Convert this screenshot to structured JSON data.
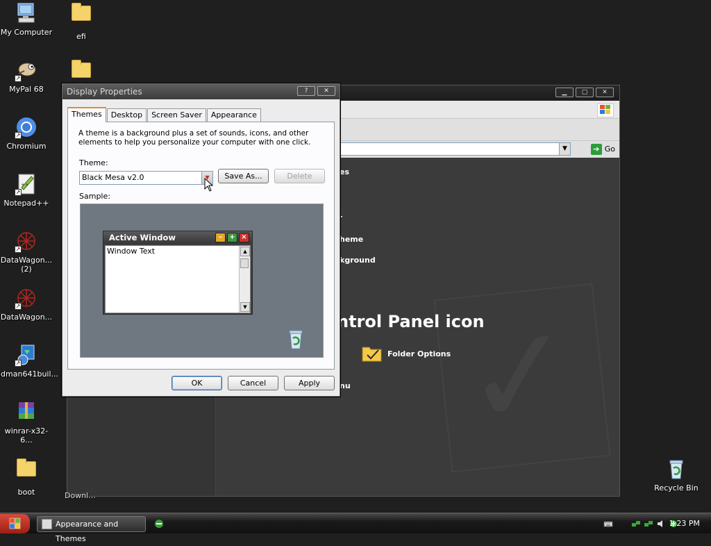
{
  "desktop": {
    "icons_left": [
      {
        "label": "My Computer"
      },
      {
        "label": "MyPal 68"
      },
      {
        "label": "Chromium"
      },
      {
        "label": "Notepad++"
      },
      {
        "label": "DataWagon... (2)"
      },
      {
        "label": "DataWagon..."
      },
      {
        "label": "idman641buil..."
      },
      {
        "label": "winrar-x32-6..."
      },
      {
        "label": "boot"
      }
    ],
    "icons_col2": [
      {
        "label": "efi"
      }
    ],
    "recycle_bin": {
      "label": "Recycle Bin"
    }
  },
  "control_panel": {
    "go_label": "Go",
    "partial_items": {
      "a": "es",
      "b": "-",
      "c": "heme",
      "d": "kground",
      "e": "nu"
    },
    "heading": "ntrol Panel icon",
    "folder_options": "Folder Options",
    "behind_label": "Downl..."
  },
  "dialog": {
    "title": "Display Properties",
    "help_btn": "?",
    "close_btn": "✕",
    "tabs": [
      "Themes",
      "Desktop",
      "Screen Saver",
      "Appearance"
    ],
    "description": "A theme is a background plus a set of sounds, icons, and other elements to help you personalize your computer with one click.",
    "theme_label": "Theme:",
    "theme_value": "Black Mesa v2.0",
    "save_as": "Save As...",
    "delete": "Delete",
    "sample_label": "Sample:",
    "sample": {
      "active_window_title": "Active Window",
      "window_text": "Window Text"
    },
    "ok": "OK",
    "cancel": "Cancel",
    "apply": "Apply"
  },
  "taskbar": {
    "task_label": "Appearance and Themes",
    "clock": "1:23 PM"
  }
}
